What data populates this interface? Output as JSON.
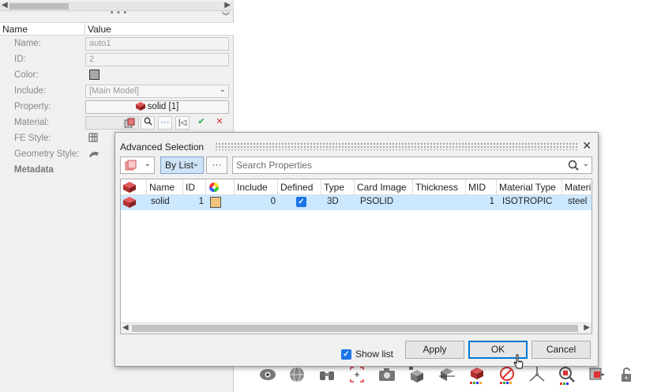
{
  "panel": {
    "header": {
      "name_col": "Name",
      "value_col": "Value"
    },
    "splitter": "• • •",
    "rows": {
      "name": {
        "label": "Name:",
        "value": "auto1"
      },
      "id": {
        "label": "ID:",
        "value": "2"
      },
      "color": {
        "label": "Color:"
      },
      "include": {
        "label": "Include:",
        "value": "[Main Model]"
      },
      "property": {
        "label": "Property:",
        "value": "solid [1]"
      },
      "material": {
        "label": "Material:"
      },
      "fe_style": {
        "label": "FE Style:"
      },
      "geometry_style": {
        "label": "Geometry Style:"
      },
      "metadata": {
        "label": "Metadata"
      }
    },
    "material_tools": {
      "search": "search-icon",
      "more": "···",
      "first": "|◁",
      "accept": "✔",
      "reject": "✕"
    }
  },
  "dialog": {
    "title": "Advanced Selection",
    "close": "✕",
    "filter_mode": "By List",
    "more": "···",
    "search_placeholder": "Search Properties",
    "columns": [
      "Name",
      "ID",
      "",
      "Include",
      "Defined",
      "Type",
      "Card Image",
      "Thickness",
      "MID",
      "Material Type",
      "Materi"
    ],
    "rows": [
      {
        "name": "solid",
        "id": "1",
        "color": "#f0c27a",
        "include": "0",
        "defined": true,
        "type": "3D",
        "card_image": "PSOLID",
        "thickness": "",
        "mid": "1",
        "material_type": "ISOTROPIC",
        "material": "steel"
      }
    ],
    "show_list_label": "Show list",
    "show_list_checked": true,
    "buttons": {
      "apply": "Apply",
      "ok": "OK",
      "cancel": "Cancel"
    }
  },
  "colors": {
    "selection_row": "#cce8ff",
    "accent": "#0078d7",
    "property_color": "#f0c27a"
  }
}
